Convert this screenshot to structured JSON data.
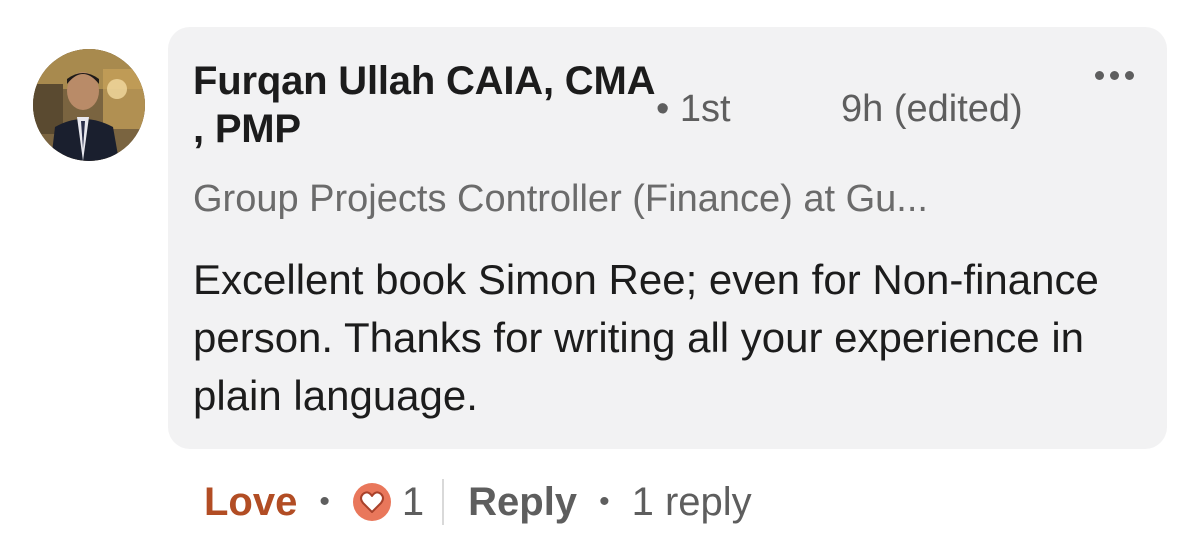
{
  "comment": {
    "author_name": "Furqan Ullah CAIA, CMA , PMP",
    "connection_degree": "• 1st",
    "timestamp": "9h (edited)",
    "headline": "Group Projects Controller (Finance) at Gu...",
    "text": "Excellent book Simon Ree; even for Non-finance person. Thanks for writing all your experience in plain language.",
    "more_icon": "ellipsis-icon",
    "avatar": "profile-photo"
  },
  "actions": {
    "reaction_label": "Love",
    "separator": "•",
    "reaction_icon": "heart-reaction-icon",
    "reaction_count": "1",
    "reply_label": "Reply",
    "replies_count_label": "1 reply"
  },
  "colors": {
    "bubble_background": "#f2f2f3",
    "love_accent": "#b24d24",
    "reaction_icon_fill": "#e9775b",
    "secondary_text": "#5e5e5e",
    "primary_text": "#1c1c1c"
  }
}
